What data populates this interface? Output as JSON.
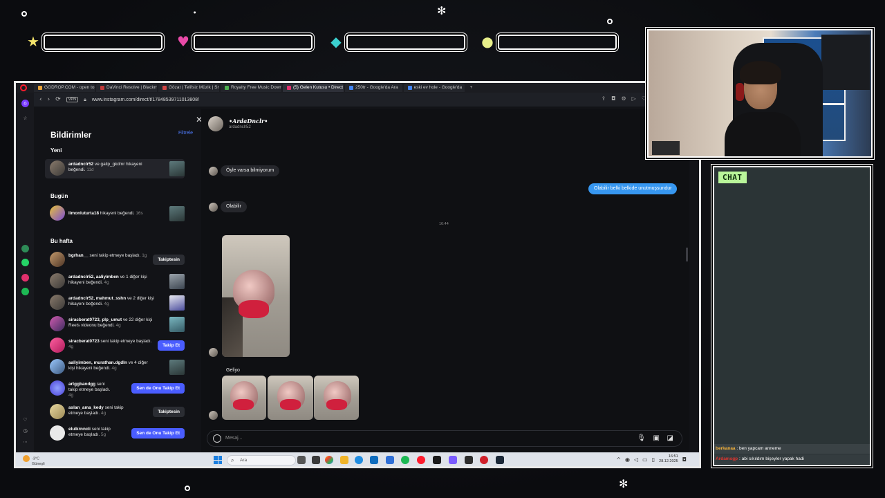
{
  "overlay": {
    "stat_icons": [
      "star-icon",
      "heart-icon",
      "diamond-icon",
      "coin-icon"
    ],
    "colors": {
      "star": "#f4e46b",
      "heart": "#e94aa8",
      "diamond": "#3bd0d0",
      "coin": "#e8ef8a",
      "chat_label_bg": "#b9f59a"
    }
  },
  "browser": {
    "tabs": [
      {
        "label": "GGDROP.COM - open top",
        "active": false
      },
      {
        "label": "DaVinci Resolve | Blackm",
        "active": false
      },
      {
        "label": "Gözat | Telifsiz Müzik | Sn",
        "active": false
      },
      {
        "label": "Royalty Free Music Down",
        "active": false
      },
      {
        "label": "(5) Gelen Kutusu • Direct",
        "active": true
      },
      {
        "label": "250tr - Google'da Ara",
        "active": false
      },
      {
        "label": "eski ev hole - Google'da",
        "active": false
      }
    ],
    "new_tab": "+",
    "vpn": "VPN",
    "url": "www.instagram.com/direct/t/17848539711013808/"
  },
  "notifications": {
    "title": "Bildirimler",
    "filter": "Filtrele",
    "sections": {
      "new": "Yeni",
      "today": "Bugün",
      "week": "Bu hafta"
    },
    "items": [
      {
        "user": "ardadnclr52",
        "text": " ve galip_gkdmr hikayeni beğendi.",
        "time": "11d",
        "action": "thumb"
      },
      {
        "user": "limonluturta18",
        "text": " hikayeni beğendi.",
        "time": "16s",
        "action": "thumb"
      },
      {
        "user": "bgrhan__",
        "text": " seni takip etmeye başladı.",
        "time": "1g",
        "action": "Takiptesin"
      },
      {
        "user": "ardadnclr52, aaliyimben",
        "text": " ve 1 diğer kişi hikayeni beğendi.",
        "time": "4g",
        "action": "thumb"
      },
      {
        "user": "ardadnclr52, mahmut_sshn",
        "text": " ve 2 diğer kişi hikayeni beğendi.",
        "time": "4g",
        "action": "thumb"
      },
      {
        "user": "siracberat0723, plp_umut",
        "text": " ve 22 diğer kişi Reels videonu beğendi.",
        "time": "4g",
        "action": "thumb"
      },
      {
        "user": "siracberat0723",
        "text": " seni takip etmeye başladı.",
        "time": "4g",
        "action": "Takip Et"
      },
      {
        "user": "aaliyimben, murathan.dgdln",
        "text": " ve 4 diğer kişi hikayeni beğendi.",
        "time": "4g",
        "action": "thumb"
      },
      {
        "user": "artggbandgg",
        "text": " seni takip etmeye başladı.",
        "time": "4g",
        "action": "Sen de Onu Takip Et"
      },
      {
        "user": "aslan_ama_kedy",
        "text": " seni takip etmeye başladı.",
        "time": "4g",
        "action": "Takiptesin"
      },
      {
        "user": "elulkrnncli",
        "text": " seni takip etmeye başladı.",
        "time": "5g",
        "action": "Sen de Onu Takip Et"
      }
    ]
  },
  "dm": {
    "name": "•ArdaDnclr•",
    "handle": "ardadnclr52",
    "messages": {
      "m1": "Öyle varsa bilmiyorum",
      "m2": "Olabilir belki belkide unutmuşsundur",
      "m3": "Olabilir",
      "time": "16:44",
      "m4": "Geliyo"
    },
    "placeholder": "Mesaj..."
  },
  "taskbar": {
    "weather_temp": "-3°C",
    "weather_desc": "Güneşli",
    "search": "Ara",
    "time": "16:51",
    "date": "28.12.2025"
  },
  "chat": {
    "label": "CHAT",
    "messages": [
      {
        "user": "berkanaa",
        "text": " : ben yapcam anneme"
      },
      {
        "user": "Ardamsgp",
        "text": " : abi sıkıldım bişeyler yapak hadi"
      }
    ]
  }
}
